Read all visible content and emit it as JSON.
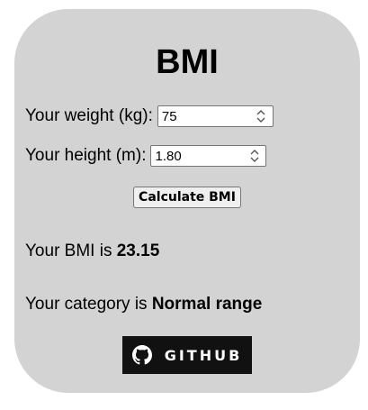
{
  "app": {
    "title": "BMI"
  },
  "form": {
    "weight_label": "Your weight (kg):",
    "weight_value": "75",
    "height_label": "Your height (m):",
    "height_value": "1.80",
    "calculate_label": "Calculate BMI"
  },
  "result": {
    "bmi_prefix": "Your BMI is ",
    "bmi_value": "23.15",
    "category_prefix": "Your category is ",
    "category_value": "Normal range"
  },
  "footer": {
    "github_label": "GITHUB",
    "github_icon": "github-icon"
  },
  "colors": {
    "card_background": "#d3d3d3",
    "github_background": "#111111"
  }
}
